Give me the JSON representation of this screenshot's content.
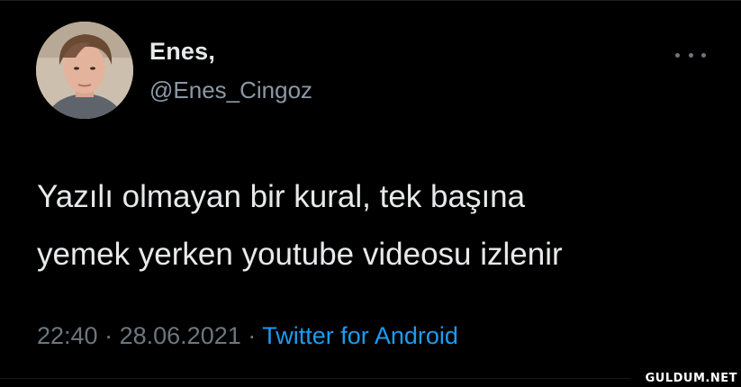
{
  "tweet": {
    "author": {
      "display_name": "Enes,",
      "handle": "@Enes_Cingoz",
      "avatar_icon": "profile-photo"
    },
    "text_lines": [
      "Yazılı olmayan bir kural, tek başına",
      "yemek yerken youtube videosu izlenir"
    ],
    "time": "22:40",
    "separator": "·",
    "date": "28.06.2021",
    "source": "Twitter for Android",
    "more_icon": "more-horizontal-icon"
  },
  "watermark": "GULDUM.NET",
  "colors": {
    "background": "#000000",
    "text": "#e7e9ea",
    "secondary": "#6e767d",
    "accent": "#1d9bf0"
  }
}
